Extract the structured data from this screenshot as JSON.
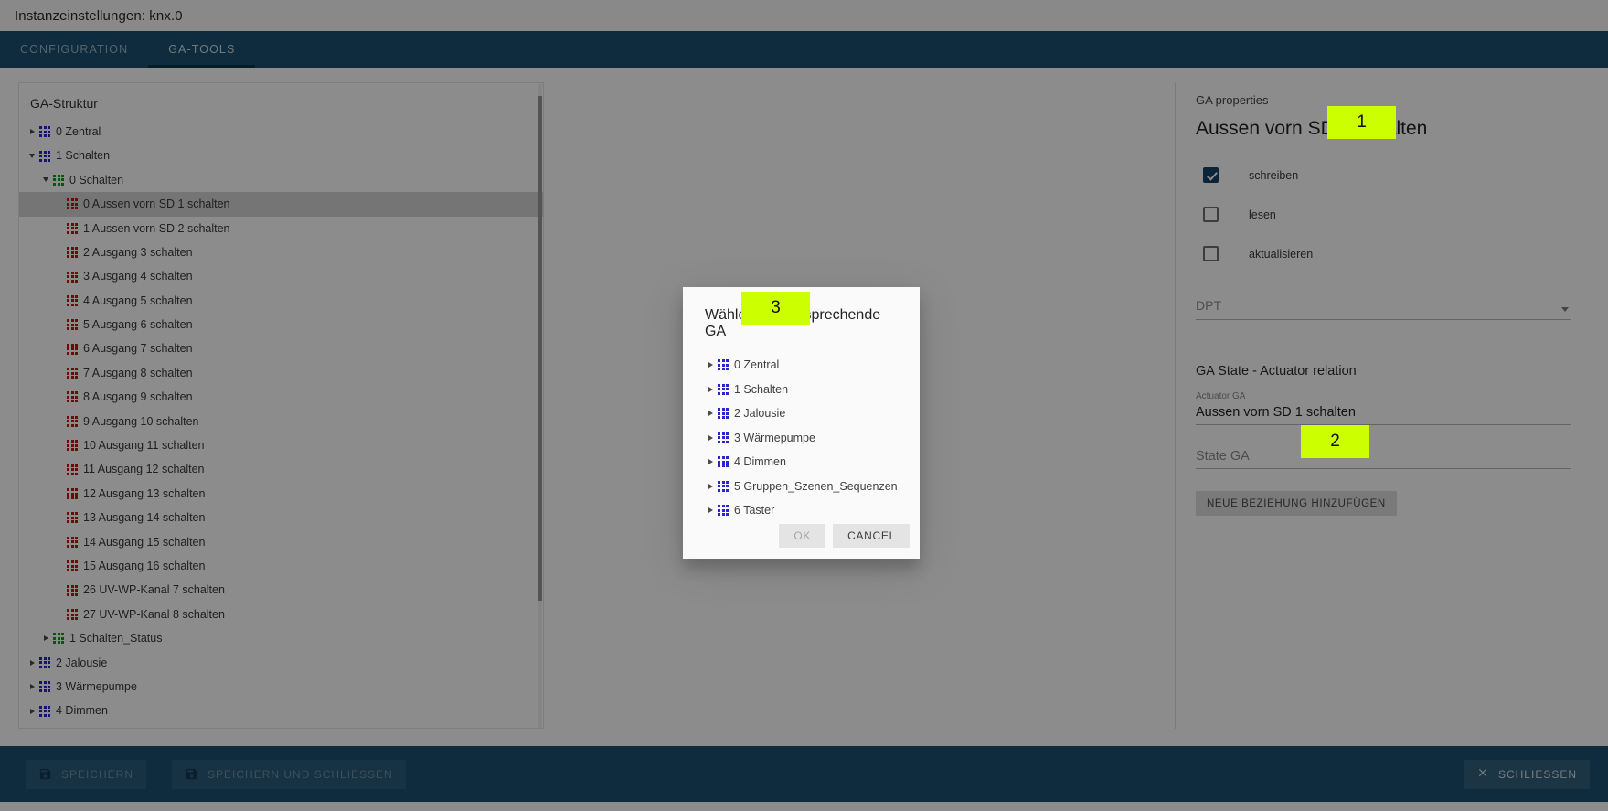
{
  "window": {
    "title": "Instanzeinstellungen: knx.0"
  },
  "tabs": [
    {
      "label": "CONFIGURATION",
      "active": false
    },
    {
      "label": "GA-TOOLS",
      "active": true
    }
  ],
  "tree_panel": {
    "caption": "GA-Struktur",
    "items": [
      {
        "label": "0 Zentral",
        "indent": 0,
        "caret": "right",
        "color": "blue",
        "selected": false
      },
      {
        "label": "1 Schalten",
        "indent": 0,
        "caret": "down",
        "color": "blue",
        "selected": false
      },
      {
        "label": "0 Schalten",
        "indent": 1,
        "caret": "down",
        "color": "green",
        "selected": false
      },
      {
        "label": "0 Aussen vorn SD 1 schalten",
        "indent": 2,
        "caret": "none",
        "color": "red",
        "selected": true
      },
      {
        "label": "1 Aussen vorn SD 2 schalten",
        "indent": 2,
        "caret": "none",
        "color": "red",
        "selected": false
      },
      {
        "label": "2 Ausgang 3 schalten",
        "indent": 2,
        "caret": "none",
        "color": "red",
        "selected": false
      },
      {
        "label": "3 Ausgang 4 schalten",
        "indent": 2,
        "caret": "none",
        "color": "red",
        "selected": false
      },
      {
        "label": "4 Ausgang 5 schalten",
        "indent": 2,
        "caret": "none",
        "color": "red",
        "selected": false
      },
      {
        "label": "5 Ausgang 6 schalten",
        "indent": 2,
        "caret": "none",
        "color": "red",
        "selected": false
      },
      {
        "label": "6 Ausgang 7 schalten",
        "indent": 2,
        "caret": "none",
        "color": "red",
        "selected": false
      },
      {
        "label": "7 Ausgang 8 schalten",
        "indent": 2,
        "caret": "none",
        "color": "red",
        "selected": false
      },
      {
        "label": "8 Ausgang 9 schalten",
        "indent": 2,
        "caret": "none",
        "color": "red",
        "selected": false
      },
      {
        "label": "9 Ausgang 10 schalten",
        "indent": 2,
        "caret": "none",
        "color": "red",
        "selected": false
      },
      {
        "label": "10 Ausgang 11 schalten",
        "indent": 2,
        "caret": "none",
        "color": "red",
        "selected": false
      },
      {
        "label": "11 Ausgang 12 schalten",
        "indent": 2,
        "caret": "none",
        "color": "red",
        "selected": false
      },
      {
        "label": "12 Ausgang 13 schalten",
        "indent": 2,
        "caret": "none",
        "color": "red",
        "selected": false
      },
      {
        "label": "13 Ausgang 14 schalten",
        "indent": 2,
        "caret": "none",
        "color": "red",
        "selected": false
      },
      {
        "label": "14 Ausgang 15 schalten",
        "indent": 2,
        "caret": "none",
        "color": "red",
        "selected": false
      },
      {
        "label": "15 Ausgang 16 schalten",
        "indent": 2,
        "caret": "none",
        "color": "red",
        "selected": false
      },
      {
        "label": "26 UV-WP-Kanal 7 schalten",
        "indent": 2,
        "caret": "none",
        "color": "red",
        "selected": false
      },
      {
        "label": "27 UV-WP-Kanal 8 schalten",
        "indent": 2,
        "caret": "none",
        "color": "red",
        "selected": false
      },
      {
        "label": "1 Schalten_Status",
        "indent": 1,
        "caret": "right",
        "color": "green",
        "selected": false
      },
      {
        "label": "2 Jalousie",
        "indent": 0,
        "caret": "right",
        "color": "blue",
        "selected": false
      },
      {
        "label": "3 Wärmepumpe",
        "indent": 0,
        "caret": "right",
        "color": "blue",
        "selected": false
      },
      {
        "label": "4 Dimmen",
        "indent": 0,
        "caret": "right",
        "color": "blue",
        "selected": false
      }
    ]
  },
  "properties": {
    "caption": "GA properties",
    "title": "Aussen vorn SD 1 schalten",
    "checkboxes": [
      {
        "label": "schreiben",
        "checked": true
      },
      {
        "label": "lesen",
        "checked": false
      },
      {
        "label": "aktualisieren",
        "checked": false
      }
    ],
    "dpt": {
      "placeholder": "DPT",
      "value": ""
    },
    "relation": {
      "heading": "GA State - Actuator relation",
      "actuator_label": "Actuator GA",
      "actuator_value": "Aussen vorn SD 1 schalten",
      "state_placeholder": "State GA",
      "state_value": "",
      "add_button": "NEUE BEZIEHUNG HINZUFÜGEN"
    }
  },
  "badges": [
    {
      "id": "1",
      "text": "1",
      "color": "#ccff00"
    },
    {
      "id": "2",
      "text": "2",
      "color": "#ccff00"
    },
    {
      "id": "3",
      "text": "3",
      "color": "#ccff00"
    }
  ],
  "dialog": {
    "title": "Wählen Sie entsprechende GA",
    "items": [
      {
        "label": "0 Zentral",
        "color": "blue"
      },
      {
        "label": "1 Schalten",
        "color": "blue"
      },
      {
        "label": "2 Jalousie",
        "color": "blue"
      },
      {
        "label": "3 Wärmepumpe",
        "color": "blue"
      },
      {
        "label": "4 Dimmen",
        "color": "blue"
      },
      {
        "label": "5 Gruppen_Szenen_Sequenzen",
        "color": "blue"
      },
      {
        "label": "6 Taster",
        "color": "blue"
      }
    ],
    "ok_label": "OK",
    "cancel_label": "CANCEL"
  },
  "bottom_bar": {
    "save_label": "SPEICHERN",
    "save_close_label": "SPEICHERN UND SCHLIESSEN",
    "close_label": "SCHLIESSEN"
  }
}
